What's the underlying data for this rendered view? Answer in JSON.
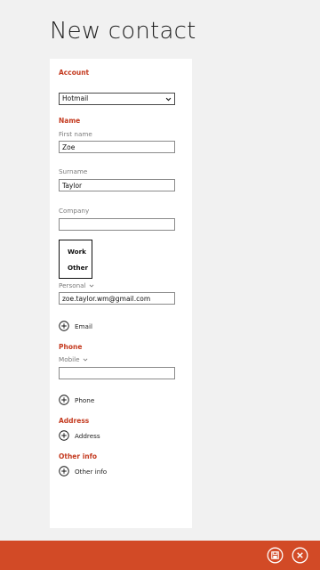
{
  "page": {
    "title": "New contact"
  },
  "account": {
    "section_title": "Account",
    "selected": "Hotmail"
  },
  "name": {
    "section_title": "Name",
    "first_name_label": "First name",
    "first_name_value": "Zoe",
    "surname_label": "Surname",
    "surname_value": "Taylor",
    "company_label": "Company",
    "company_value": ""
  },
  "email_type_menu": {
    "options": [
      "Work",
      "Other"
    ]
  },
  "email": {
    "type_label": "Personal",
    "value": "zoe.taylor.wm@gmail.com",
    "add_label": "Email"
  },
  "phone": {
    "section_title": "Phone",
    "type_label": "Mobile",
    "value": "",
    "add_label": "Phone"
  },
  "address": {
    "section_title": "Address",
    "add_label": "Address"
  },
  "other_info": {
    "section_title": "Other info",
    "add_label": "Other info"
  },
  "appbar": {
    "buttons": [
      {
        "icon": "save-icon"
      },
      {
        "icon": "cancel-icon"
      }
    ]
  },
  "colors": {
    "accent": "#c43a1f",
    "appbar": "#d24a26",
    "background": "#f1f1f1",
    "panel": "#ffffff"
  }
}
